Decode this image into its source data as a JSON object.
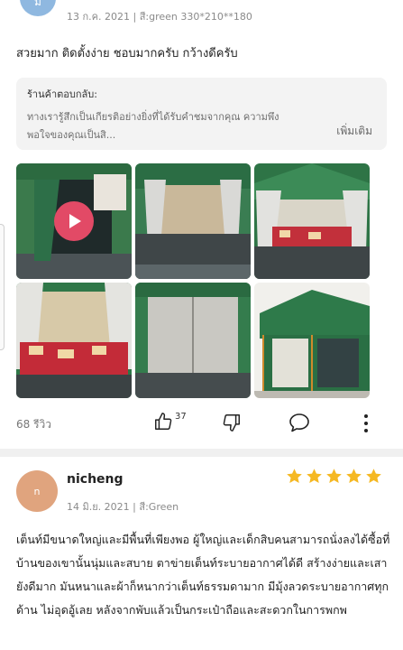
{
  "review1": {
    "avatar_letter": "ม",
    "meta": "13 ก.ค. 2021 | สี:green 330*210**180",
    "text": "สวยมาก ติดตั้งง่าย ชอบมากครับ กว้างดีครับ",
    "seller_reply": {
      "title": "ร้านค้าตอบกลับ:",
      "text": "ทางเรารู้สึกเป็นเกียรติอย่างยิ่งที่ได้รับคำชมจากคุณ ความพึงพอใจของคุณเป็นสิ...",
      "more": "เพิ่มเติม"
    },
    "photos": [
      {
        "icon": "tent-entrance-video-thumbnail"
      },
      {
        "icon": "tent-interior-curtains-photo"
      },
      {
        "icon": "tent-bedding-photo"
      },
      {
        "icon": "tent-bedding-curtains-photo"
      },
      {
        "icon": "tent-inner-mesh-photo"
      },
      {
        "icon": "tent-exterior-photo"
      }
    ]
  },
  "actions": {
    "reviews_count": "68 รีวิว",
    "like_count": "37"
  },
  "review2": {
    "avatar_letter": "n",
    "username": "nicheng",
    "meta": "14 มิ.ย. 2021 | สี:Green",
    "rating": 5,
    "text": "เต็นท์มีขนาดใหญ่และมีพื้นที่เพียงพอ ผู้ใหญ่และเด็กสิบคนสามารถนั่งลงได้ซื้อที่บ้านของเขานั้นนุ่มและสบาย ตาข่ายเต็นท์ระบายอากาศได้ดี สร้างง่ายและเสายังดีมาก มันหนาและผ้าก็หนากว่าเต็นท์ธรรมดามาก มีมุ้งลวดระบายอากาศทุกด้าน ไม่อุดอู้เลย หลังจากพับแล้วเป็นกระเป๋าถือและสะดวกในการพกพ"
  },
  "colors": {
    "tent_green": "#2f7a4a",
    "star_yellow": "#f5b823",
    "play_red": "#e24a66"
  }
}
